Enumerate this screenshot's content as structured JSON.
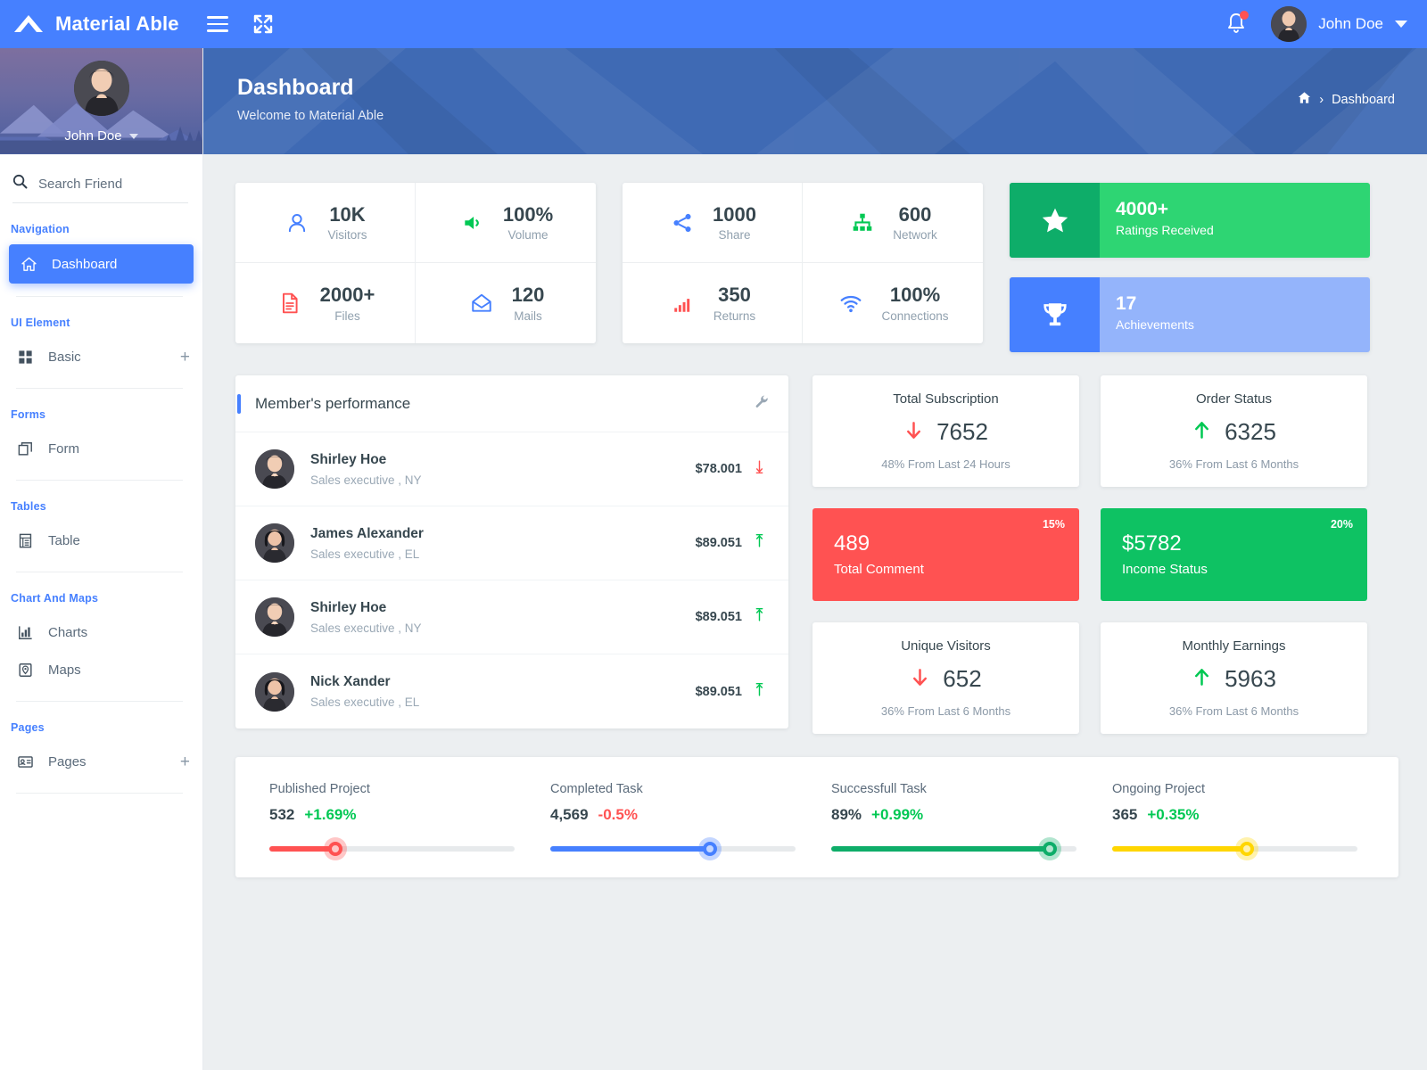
{
  "topbar": {
    "brand": "Material Able",
    "menu_icon": "hamburger-icon",
    "expand_icon": "expand-icon",
    "bell_icon": "notification-bell-icon",
    "user_name": "John Doe"
  },
  "sidebar": {
    "profile_name": "John Doe",
    "search_placeholder": "Search Friend",
    "sections": [
      {
        "caption": "Navigation",
        "items": [
          {
            "label": "Dashboard",
            "icon": "home-icon",
            "active": true,
            "expandable": false
          }
        ]
      },
      {
        "caption": "UI Element",
        "items": [
          {
            "label": "Basic",
            "icon": "grid-icon",
            "active": false,
            "expandable": true,
            "plus": "+"
          }
        ]
      },
      {
        "caption": "Forms",
        "items": [
          {
            "label": "Form",
            "icon": "form-icon",
            "active": false,
            "expandable": false
          }
        ]
      },
      {
        "caption": "Tables",
        "items": [
          {
            "label": "Table",
            "icon": "table-icon",
            "active": false,
            "expandable": false
          }
        ]
      },
      {
        "caption": "Chart And Maps",
        "items": [
          {
            "label": "Charts",
            "icon": "chart-icon",
            "active": false,
            "expandable": false
          },
          {
            "label": "Maps",
            "icon": "map-icon",
            "active": false,
            "expandable": false
          }
        ]
      },
      {
        "caption": "Pages",
        "items": [
          {
            "label": "Pages",
            "icon": "pages-icon",
            "active": false,
            "expandable": true,
            "plus": "+"
          }
        ]
      }
    ]
  },
  "banner": {
    "title": "Dashboard",
    "subtitle": "Welcome to Material Able",
    "breadcrumb_home_icon": "home-icon",
    "breadcrumb_separator": "›",
    "breadcrumb_current": "Dashboard"
  },
  "stats_left": [
    {
      "value": "10K",
      "label": "Visitors",
      "icon": "user-icon",
      "color": "#4680ff"
    },
    {
      "value": "100%",
      "label": "Volume",
      "icon": "speaker-icon",
      "color": "#00c853"
    },
    {
      "value": "2000+",
      "label": "Files",
      "icon": "file-icon",
      "color": "#ff5252"
    },
    {
      "value": "120",
      "label": "Mails",
      "icon": "mail-icon",
      "color": "#4680ff"
    }
  ],
  "stats_mid": [
    {
      "value": "1000",
      "label": "Share",
      "icon": "share-icon",
      "color": "#4680ff"
    },
    {
      "value": "600",
      "label": "Network",
      "icon": "network-icon",
      "color": "#00c853"
    },
    {
      "value": "350",
      "label": "Returns",
      "icon": "bars-icon",
      "color": "#ff5252"
    },
    {
      "value": "100%",
      "label": "Connections",
      "icon": "wifi-icon",
      "color": "#4680ff"
    }
  ],
  "highlight_cards": [
    {
      "value": "4000+",
      "label": "Ratings Received",
      "icon": "star-icon",
      "icon_bg": "#0ead69",
      "body_bg": "#2ed573"
    },
    {
      "value": "17",
      "label": "Achievements",
      "icon": "trophy-icon",
      "icon_bg": "#4680ff",
      "body_bg": "#94b4fb"
    }
  ],
  "performance": {
    "title": "Member's performance",
    "settings_icon": "wrench-icon",
    "members": [
      {
        "name": "Shirley Hoe",
        "role": "Sales executive , NY",
        "amount": "$78.001",
        "trend": "down",
        "trend_color": "#ff5252"
      },
      {
        "name": "James Alexander",
        "role": "Sales executive , EL",
        "amount": "$89.051",
        "trend": "up",
        "trend_color": "#00c853"
      },
      {
        "name": "Shirley Hoe",
        "role": "Sales executive , NY",
        "amount": "$89.051",
        "trend": "up",
        "trend_color": "#00c853"
      },
      {
        "name": "Nick Xander",
        "role": "Sales executive , EL",
        "amount": "$89.051",
        "trend": "up",
        "trend_color": "#00c853"
      }
    ]
  },
  "metrics_top": [
    {
      "title": "Total Subscription",
      "value": "7652",
      "direction": "down",
      "arrow_color": "#ff5252",
      "sub": "48% From Last 24 Hours"
    },
    {
      "title": "Order Status",
      "value": "6325",
      "direction": "up",
      "arrow_color": "#00c853",
      "sub": "36% From Last 6 Months"
    }
  ],
  "metrics_color": [
    {
      "value": "489",
      "label": "Total Comment",
      "percent": "15%",
      "bg": "#ff5252"
    },
    {
      "value": "$5782",
      "label": "Income Status",
      "percent": "20%",
      "bg": "#0ec263"
    }
  ],
  "metrics_bottom": [
    {
      "title": "Unique Visitors",
      "value": "652",
      "direction": "down",
      "arrow_color": "#ff5252",
      "sub": "36% From Last 6 Months"
    },
    {
      "title": "Monthly Earnings",
      "value": "5963",
      "direction": "up",
      "arrow_color": "#00c853",
      "sub": "36% From Last 6 Months"
    }
  ],
  "progress": [
    {
      "title": "Published Project",
      "value": "532",
      "delta": "+1.69%",
      "delta_color": "#00c853",
      "percent": 27,
      "color": "#ff5252"
    },
    {
      "title": "Completed Task",
      "value": "4,569",
      "delta": "-0.5%",
      "delta_color": "#ff5252",
      "percent": 65,
      "color": "#4680ff"
    },
    {
      "title": "Successfull Task",
      "value": "89%",
      "delta": "+0.99%",
      "delta_color": "#00c853",
      "percent": 89,
      "color": "#0ead69"
    },
    {
      "title": "Ongoing Project",
      "value": "365",
      "delta": "+0.35%",
      "delta_color": "#00c853",
      "percent": 55,
      "color": "#ffd600"
    }
  ]
}
